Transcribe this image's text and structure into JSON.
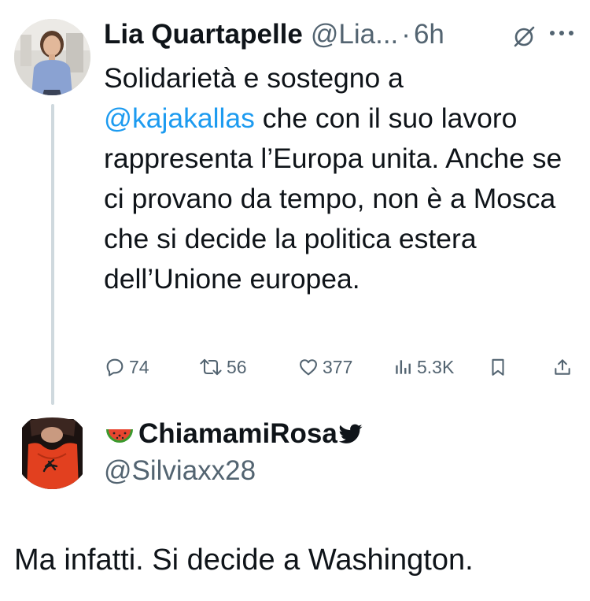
{
  "tweet": {
    "author": {
      "display_name": "Lia Quartapelle",
      "handle": "@Lia...",
      "separator": "·",
      "time": "6h"
    },
    "text_before": "Solidarietà e sostegno a",
    "mention": "@kajakallas",
    "text_after": " che con il suo lavoro rappresenta l’Europa unita. Anche se ci provano da tempo, non è a Mosca che si decide la politica estera dell’Unione europea.",
    "stats": {
      "replies": "74",
      "reposts": "56",
      "likes": "377",
      "views": "5.3K"
    },
    "icons": {
      "header": [
        "grok-icon",
        "more-icon"
      ],
      "actions": [
        "reply-icon",
        "repost-icon",
        "like-icon",
        "views-icon",
        "bookmark-icon",
        "share-icon"
      ]
    }
  },
  "reply": {
    "emoji": "🍉",
    "display_name": "ChiamamiRosa",
    "bird_icon": "twitter-bird-icon",
    "handle": "@Silviaxx28",
    "text": "Ma infatti. Si decide a Washington."
  },
  "colors": {
    "text": "#0f1419",
    "secondary": "#536471",
    "link": "#1d9bf0",
    "thread_line": "#cfd9de"
  }
}
